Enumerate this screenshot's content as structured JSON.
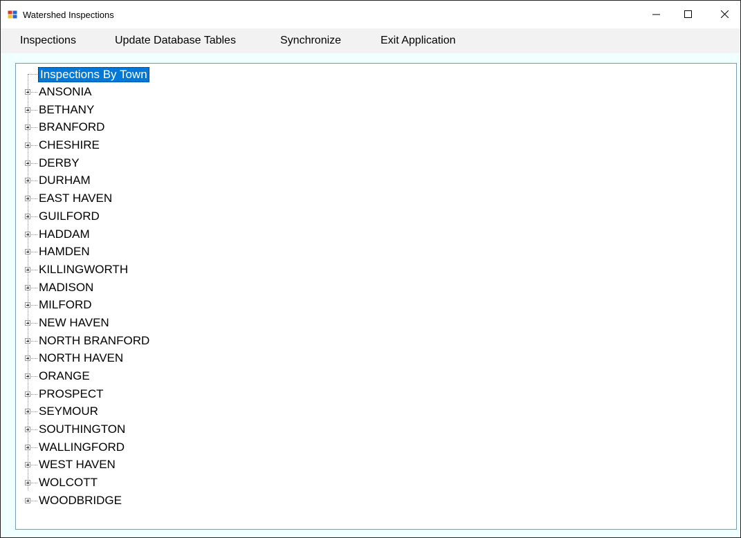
{
  "window": {
    "title": "Watershed Inspections",
    "controls": {
      "minimize_icon": "minimize-icon",
      "maximize_icon": "maximize-icon",
      "close_icon": "close-icon"
    }
  },
  "menu": {
    "items": [
      {
        "label": "Inspections"
      },
      {
        "label": "Update Database Tables"
      },
      {
        "label": "Synchronize"
      },
      {
        "label": "Exit Application"
      }
    ]
  },
  "tree": {
    "root": {
      "label": "Inspections By Town",
      "selected": true
    },
    "towns": [
      {
        "label": "ANSONIA"
      },
      {
        "label": "BETHANY"
      },
      {
        "label": "BRANFORD"
      },
      {
        "label": "CHESHIRE"
      },
      {
        "label": "DERBY"
      },
      {
        "label": "DURHAM"
      },
      {
        "label": "EAST HAVEN"
      },
      {
        "label": "GUILFORD"
      },
      {
        "label": "HADDAM"
      },
      {
        "label": "HAMDEN"
      },
      {
        "label": "KILLINGWORTH"
      },
      {
        "label": "MADISON"
      },
      {
        "label": "MILFORD"
      },
      {
        "label": "NEW HAVEN"
      },
      {
        "label": "NORTH BRANFORD"
      },
      {
        "label": "NORTH HAVEN"
      },
      {
        "label": "ORANGE"
      },
      {
        "label": "PROSPECT"
      },
      {
        "label": "SEYMOUR"
      },
      {
        "label": "SOUTHINGTON"
      },
      {
        "label": "WALLINGFORD"
      },
      {
        "label": "WEST HAVEN"
      },
      {
        "label": "WOLCOTT"
      },
      {
        "label": "WOODBRIDGE"
      }
    ]
  },
  "colors": {
    "selection": "#0078d7",
    "client_background": "#f0ffff",
    "menubar_background": "#f2f2f2"
  }
}
